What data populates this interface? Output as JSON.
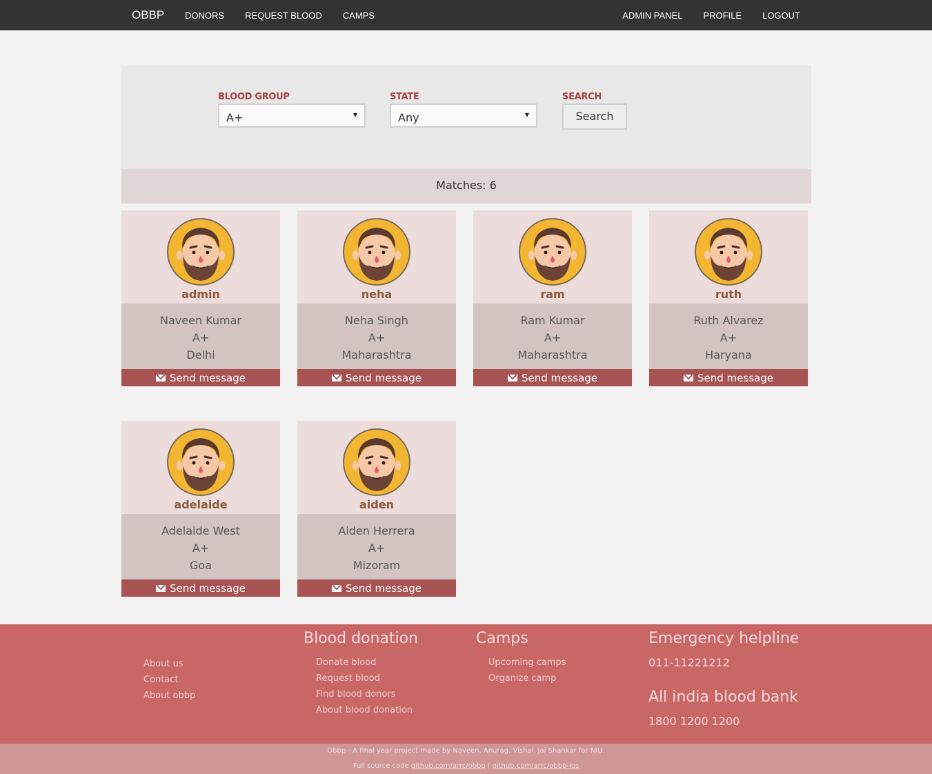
{
  "navbar": {
    "brand": "OBBP",
    "left_items": [
      "DONORS",
      "REQUEST BLOOD",
      "CAMPS"
    ],
    "right_items": [
      "ADMIN PANEL",
      "PROFILE",
      "LOGOUT"
    ]
  },
  "search": {
    "blood_group_label": "BLOOD GROUP",
    "blood_group_value": "A+",
    "state_label": "STATE",
    "state_value": "Any",
    "search_label": "SEARCH",
    "search_button": "Search"
  },
  "matches": "Matches: 6",
  "donors": [
    {
      "username": "admin",
      "name": "Naveen Kumar",
      "blood": "A+",
      "state": "Delhi",
      "action": "Send message"
    },
    {
      "username": "neha",
      "name": "Neha Singh",
      "blood": "A+",
      "state": "Maharashtra",
      "action": "Send message"
    },
    {
      "username": "ram",
      "name": "Ram Kumar",
      "blood": "A+",
      "state": "Maharashtra",
      "action": "Send message"
    },
    {
      "username": "ruth",
      "name": "Ruth Alvarez",
      "blood": "A+",
      "state": "Haryana",
      "action": "Send message"
    },
    {
      "username": "adelaide",
      "name": "Adelaide West",
      "blood": "A+",
      "state": "Goa",
      "action": "Send message"
    },
    {
      "username": "aiden",
      "name": "Aiden Herrera",
      "blood": "A+",
      "state": "Mizoram",
      "action": "Send message"
    }
  ],
  "footer": {
    "about_links": [
      "About us",
      "Contact",
      "About obbp"
    ],
    "donation_title": "Blood donation",
    "donation_links": [
      "Donate blood",
      "Request blood",
      "Find blood donors",
      "About blood donation"
    ],
    "camps_title": "Camps",
    "camps_links": [
      "Upcoming camps",
      "Organize camp"
    ],
    "helpline_title": "Emergency helpline",
    "helpline_number": "011-11221212",
    "bloodbank_title": "All india blood bank",
    "bloodbank_number": "1800 1200 1200"
  },
  "bottom": {
    "credit": "Obbp - A final year project made by Naveen, Anurag, Vishal, Jai Shankar for NIU.",
    "source_prefix": "Full source code",
    "link1": "github.com/arrc/obbp",
    "separator": "|",
    "link2": "github.com/arrc/obbp-ios"
  }
}
